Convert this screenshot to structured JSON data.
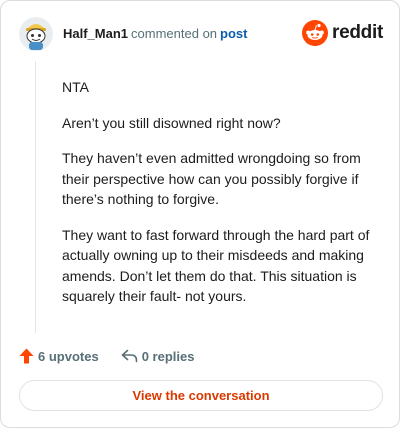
{
  "header": {
    "username": "Half_Man1",
    "commented_text": "commented on",
    "post_link": "post",
    "logo_text": "reddit"
  },
  "comment": {
    "paragraphs": [
      "NTA",
      "Aren’t you still disowned right now?",
      "They haven’t even admitted wrongdoing so from their perspective how can you possibly forgive if there’s nothing to forgive.",
      "They want to fast forward through the hard part of actually owning up to their misdeeds and making amends. Don’t let them do that. This situation is squarely their fault- not yours."
    ]
  },
  "actions": {
    "upvotes_label": "6 upvotes",
    "replies_label": "0 replies"
  },
  "cta": {
    "view_label": "View the conversation"
  },
  "colors": {
    "brand": "#ff4500",
    "link": "#0b5cad",
    "cta": "#d93a00",
    "muted": "#576f76"
  },
  "icons": {
    "avatar": "snoo-avatar",
    "logo": "reddit-snoo-icon",
    "upvote": "upvote-arrow-icon",
    "reply": "reply-arrow-icon"
  }
}
